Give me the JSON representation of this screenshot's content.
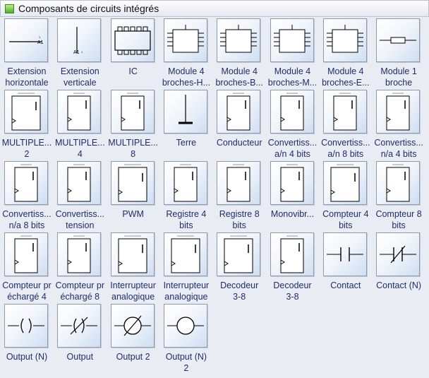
{
  "panel": {
    "title": "Composants de circuits intégrés",
    "icon": "stencil-icon"
  },
  "items": [
    {
      "line1": "Extension",
      "line2": "horizontale",
      "icon": "hline"
    },
    {
      "line1": "Extension",
      "line2": "verticale",
      "icon": "vline"
    },
    {
      "line1": "IC",
      "line2": "",
      "icon": "ic"
    },
    {
      "line1": "Module 4",
      "line2": "broches-H...",
      "icon": "module"
    },
    {
      "line1": "Module 4",
      "line2": "broches-B...",
      "icon": "module"
    },
    {
      "line1": "Module 4",
      "line2": "broches-M...",
      "icon": "module"
    },
    {
      "line1": "Module 4",
      "line2": "broches-E...",
      "icon": "module"
    },
    {
      "line1": "Module 1",
      "line2": "broche",
      "icon": "module1"
    },
    {
      "line1": "MULTIPLE...",
      "line2": "2",
      "icon": "chipwide"
    },
    {
      "line1": "MULTIPLE...",
      "line2": "4",
      "icon": "chip"
    },
    {
      "line1": "MULTIPLE...",
      "line2": "8",
      "icon": "chip"
    },
    {
      "line1": "Terre",
      "line2": "",
      "icon": "ground"
    },
    {
      "line1": "Conducteur",
      "line2": "",
      "icon": "chip"
    },
    {
      "line1": "Convertiss...",
      "line2": "a/n 4 bits",
      "icon": "chip"
    },
    {
      "line1": "Convertiss...",
      "line2": "a/n 8 bits",
      "icon": "chip"
    },
    {
      "line1": "Convertiss...",
      "line2": "n/a 4 bits",
      "icon": "chip"
    },
    {
      "line1": "Convertiss...",
      "line2": "n/a 8 bits",
      "icon": "chip"
    },
    {
      "line1": "Convertiss...",
      "line2": "tension",
      "icon": "chip"
    },
    {
      "line1": "PWM",
      "line2": "",
      "icon": "chipwide"
    },
    {
      "line1": "Registre 4",
      "line2": "bits",
      "icon": "chip"
    },
    {
      "line1": "Registre 8",
      "line2": "bits",
      "icon": "chip"
    },
    {
      "line1": "Monovibr...",
      "line2": "",
      "icon": "chip"
    },
    {
      "line1": "Compteur 4",
      "line2": "bits",
      "icon": "chipwide"
    },
    {
      "line1": "Compteur 8",
      "line2": "bits",
      "icon": "chip"
    },
    {
      "line1": "Compteur pr",
      "line2": "échargé 4",
      "icon": "chip"
    },
    {
      "line1": "Compteur pr",
      "line2": "échargé 8",
      "icon": "chip"
    },
    {
      "line1": "Interrupteur",
      "line2": "analogique",
      "icon": "chipwide"
    },
    {
      "line1": "Interrupteur",
      "line2": "analogique",
      "icon": "chipwide"
    },
    {
      "line1": "Decodeur",
      "line2": "3-8",
      "icon": "chipwide"
    },
    {
      "line1": "Decodeur",
      "line2": "3-8",
      "icon": "chip"
    },
    {
      "line1": "Contact",
      "line2": "",
      "icon": "contact"
    },
    {
      "line1": "Contact (N)",
      "line2": "",
      "icon": "contactn"
    },
    {
      "line1": "Output (N)",
      "line2": "",
      "icon": "outputn"
    },
    {
      "line1": "Output",
      "line2": "",
      "icon": "output"
    },
    {
      "line1": "Output 2",
      "line2": "",
      "icon": "output2"
    },
    {
      "line1": "Output (N)",
      "line2": "2",
      "icon": "outputn2"
    }
  ]
}
